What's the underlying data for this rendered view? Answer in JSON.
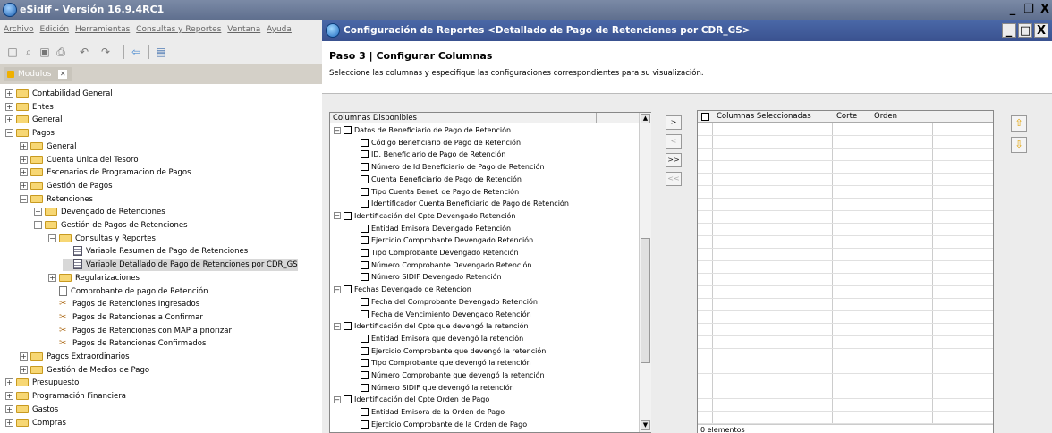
{
  "app": {
    "title": "eSidif - Versión 16.9.4RC1",
    "menu": [
      "Archivo",
      "Edición",
      "Herramientas",
      "Consultas y Reportes",
      "Ventana",
      "Ayuda"
    ],
    "modules_tab": "Modulos"
  },
  "tree": [
    {
      "label": "Contabilidad General",
      "level": 0,
      "icon": "folder",
      "expander": "+"
    },
    {
      "label": "Entes",
      "level": 0,
      "icon": "folder",
      "expander": "+"
    },
    {
      "label": "General",
      "level": 0,
      "icon": "folder",
      "expander": "+"
    },
    {
      "label": "Pagos",
      "level": 0,
      "icon": "folder",
      "expander": "-"
    },
    {
      "label": "General",
      "level": 1,
      "icon": "folder",
      "expander": "+"
    },
    {
      "label": "Cuenta Unica del Tesoro",
      "level": 1,
      "icon": "folder",
      "expander": "+"
    },
    {
      "label": "Escenarios de Programacion de Pagos",
      "level": 1,
      "icon": "folder",
      "expander": "+"
    },
    {
      "label": "Gestión de Pagos",
      "level": 1,
      "icon": "folder",
      "expander": "+"
    },
    {
      "label": "Retenciones",
      "level": 1,
      "icon": "folder",
      "expander": "-"
    },
    {
      "label": "Devengado de Retenciones",
      "level": 2,
      "icon": "folder",
      "expander": "+"
    },
    {
      "label": "Gestión de Pagos de Retenciones",
      "level": 2,
      "icon": "folder",
      "expander": "-"
    },
    {
      "label": "Consultas y Reportes",
      "level": 3,
      "icon": "folder",
      "expander": "-"
    },
    {
      "label": "Variable Resumen de Pago de Retenciones",
      "level": 4,
      "icon": "report",
      "expander": ""
    },
    {
      "label": "Variable Detallado de Pago de Retenciones por CDR_GS",
      "level": 4,
      "icon": "report",
      "expander": "",
      "selected": true
    },
    {
      "label": "Regularizaciones",
      "level": 3,
      "icon": "folder",
      "expander": "+"
    },
    {
      "label": "Comprobante de pago de Retención",
      "level": 3,
      "icon": "doc",
      "expander": ""
    },
    {
      "label": "Pagos de Retenciones Ingresados",
      "level": 3,
      "icon": "tool",
      "expander": ""
    },
    {
      "label": "Pagos de Retenciones a Confirmar",
      "level": 3,
      "icon": "tool",
      "expander": ""
    },
    {
      "label": "Pagos de Retenciones con MAP a priorizar",
      "level": 3,
      "icon": "tool",
      "expander": ""
    },
    {
      "label": "Pagos de Retenciones Confirmados",
      "level": 3,
      "icon": "tool",
      "expander": ""
    },
    {
      "label": "Pagos Extraordinarios",
      "level": 1,
      "icon": "folder",
      "expander": "+"
    },
    {
      "label": "Gestión de Medios de Pago",
      "level": 1,
      "icon": "folder",
      "expander": "+"
    },
    {
      "label": "Presupuesto",
      "level": 0,
      "icon": "folder",
      "expander": "+"
    },
    {
      "label": "Programación Financiera",
      "level": 0,
      "icon": "folder",
      "expander": "+"
    },
    {
      "label": "Gastos",
      "level": 0,
      "icon": "folder",
      "expander": "+"
    },
    {
      "label": "Compras",
      "level": 0,
      "icon": "folder",
      "expander": "+"
    }
  ],
  "dialog": {
    "title": "Configuración de Reportes <Detallado de Pago de Retenciones por CDR_GS>",
    "step": "Paso 3 | Configurar Columnas",
    "description": "Seleccione las columnas y especifique las configuraciones correspondientes para su visualización.",
    "available_header": "Columnas Disponibles",
    "available": [
      {
        "label": "Datos de Beneficiario de Pago de Retención",
        "group": true
      },
      {
        "label": "Código Beneficiario de Pago de Retención",
        "group": false
      },
      {
        "label": "ID. Beneficiario de Pago de Retención",
        "group": false
      },
      {
        "label": "Número de Id Beneficiario de Pago de Retención",
        "group": false
      },
      {
        "label": "Cuenta Beneficiario de Pago de Retención",
        "group": false
      },
      {
        "label": "Tipo Cuenta Benef. de Pago de Retención",
        "group": false
      },
      {
        "label": "Identificador Cuenta Beneficiario de Pago de Retención",
        "group": false
      },
      {
        "label": "Identificación del Cpte Devengado Retención",
        "group": true
      },
      {
        "label": "Entidad Emisora Devengado Retención",
        "group": false
      },
      {
        "label": "Ejercicio Comprobante Devengado Retención",
        "group": false
      },
      {
        "label": "Tipo Comprobante Devengado Retención",
        "group": false
      },
      {
        "label": "Número Comprobante Devengado Retención",
        "group": false
      },
      {
        "label": "Número SIDIF Devengado Retención",
        "group": false
      },
      {
        "label": "Fechas Devengado de Retencion",
        "group": true
      },
      {
        "label": "Fecha del Comprobante Devengado Retención",
        "group": false
      },
      {
        "label": "Fecha de Vencimiento Devengado Retención",
        "group": false
      },
      {
        "label": "Identificación del Cpte que devengó la retención",
        "group": true
      },
      {
        "label": "Entidad Emisora que devengó la retención",
        "group": false
      },
      {
        "label": "Ejercicio Comprobante que devengó la retención",
        "group": false
      },
      {
        "label": "Tipo Comprobante que devengó la retención",
        "group": false
      },
      {
        "label": "Número Comprobante que devengó la retención",
        "group": false
      },
      {
        "label": "Número SIDIF que devengó la retención",
        "group": false
      },
      {
        "label": "Identificación del Cpte Orden de Pago",
        "group": true
      },
      {
        "label": "Entidad Emisora de la Orden de Pago",
        "group": false
      },
      {
        "label": "Ejercicio Comprobante de la Orden de Pago",
        "group": false
      }
    ],
    "buttons": {
      "add": ">",
      "remove": "<",
      "add_all": ">>",
      "remove_all": "<<"
    },
    "selected_headers": {
      "name": "Columnas Seleccionadas",
      "cut": "Corte",
      "order": "Orden"
    },
    "selected_count": "0 elementos"
  }
}
